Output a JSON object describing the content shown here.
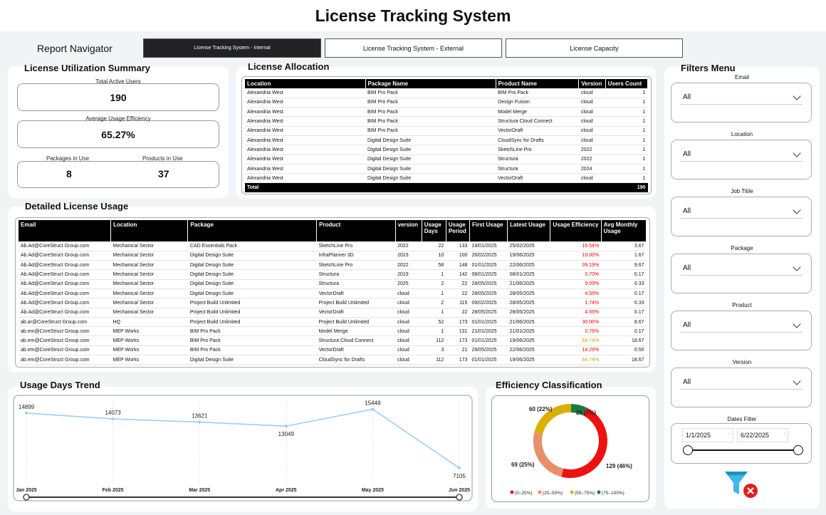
{
  "header": {
    "title": "License Tracking System"
  },
  "navigator": {
    "label": "Report Navigator",
    "buttons": [
      "License Tracking System - Internal",
      "License Tracking System - External",
      "License Capacity"
    ]
  },
  "summary": {
    "title": "License Utilization Summary",
    "total_users_label": "Total Active Users",
    "total_users": "190",
    "efficiency_label": "Average Usage Efficiency",
    "efficiency": "65.27%",
    "packages_label": "Packages in Use",
    "packages": "8",
    "products_label": "Products in Use",
    "products": "37"
  },
  "allocation": {
    "title": "License Allocation",
    "columns": [
      "Location",
      "Package Name",
      "Product Name",
      "Version",
      "Users Count"
    ],
    "rows": [
      [
        "Alexandria West",
        "BIM Pro Pack",
        "BIM Pro Pack",
        "cloud",
        "1"
      ],
      [
        "Alexandria West",
        "BIM Pro Pack",
        "Design Fusion",
        "cloud",
        "1"
      ],
      [
        "Alexandria West",
        "BIM Pro Pack",
        "Model Merge",
        "cloud",
        "1"
      ],
      [
        "Alexandria West",
        "BIM Pro Pack",
        "Structura Cloud Connect",
        "cloud",
        "1"
      ],
      [
        "Alexandria West",
        "BIM Pro Pack",
        "VectorDraft",
        "cloud",
        "1"
      ],
      [
        "Alexandria West",
        "Digital Design Suite",
        "CloudSync for Drafts",
        "cloud",
        "1"
      ],
      [
        "Alexandria West",
        "Digital Design Suite",
        "SketchLine Pro",
        "2022",
        "1"
      ],
      [
        "Alexandria West",
        "Digital Design Suite",
        "Structura",
        "2022",
        "1"
      ],
      [
        "Alexandria West",
        "Digital Design Suite",
        "Structura",
        "2024",
        "1"
      ],
      [
        "Alexandria West",
        "Digital Design Suite",
        "VectorDraft",
        "cloud",
        "1"
      ]
    ],
    "total_label": "Total",
    "total_value": "190"
  },
  "detail": {
    "title": "Detailed License Usage",
    "columns": [
      "Email",
      "Location",
      "Package",
      "Product",
      "version",
      "Usage Days",
      "Usage Period",
      "First Usage",
      "Latest Usage",
      "Usage Efficiency",
      "Avg Monthly Usage"
    ],
    "rows": [
      [
        "Ab.Ad@CoreStruct Group.com",
        "Mechanical Sector",
        "CAD Essentials Pack",
        "SketchLine Pro",
        "2022",
        "22",
        "133",
        "19/01/2025",
        "25/02/2025",
        "16.54%",
        "3.67"
      ],
      [
        "Ab.Ad@CoreStruct Group.com",
        "Mechanical Sector",
        "Digital Design Suite",
        "InfraPlanner 3D",
        "2023",
        "10",
        "100",
        "26/02/2025",
        "19/06/2025",
        "10.00%",
        "1.67"
      ],
      [
        "Ab.Ad@CoreStruct Group.com",
        "Mechanical Sector",
        "Digital Design Suite",
        "SketchLine Pro",
        "2022",
        "58",
        "148",
        "01/01/2025",
        "22/06/2025",
        "39.19%",
        "9.67"
      ],
      [
        "Ab.Ad@CoreStruct Group.com",
        "Mechanical Sector",
        "Digital Design Suite",
        "Structura",
        "2019",
        "1",
        "142",
        "08/01/2025",
        "08/01/2025",
        "0.70%",
        "0.17"
      ],
      [
        "Ab.Ad@CoreStruct Group.com",
        "Mechanical Sector",
        "Digital Design Suite",
        "Structura",
        "2025",
        "2",
        "22",
        "28/05/2025",
        "21/06/2025",
        "9.09%",
        "0.33"
      ],
      [
        "Ab.Ad@CoreStruct Group.com",
        "Mechanical Sector",
        "Digital Design Suite",
        "VectorDraft",
        "cloud",
        "1",
        "22",
        "28/05/2025",
        "28/05/2025",
        "4.55%",
        "0.17"
      ],
      [
        "Ab.Ad@CoreStruct Group.com",
        "Mechanical Sector",
        "Project Build Unlimited",
        "Project Build Unlimited",
        "cloud",
        "2",
        "115",
        "09/02/2025",
        "28/05/2025",
        "1.74%",
        "0.33"
      ],
      [
        "Ab.Ad@CoreStruct Group.com",
        "Mechanical Sector",
        "Project Build Unlimited",
        "VectorDraft",
        "cloud",
        "1",
        "22",
        "28/05/2025",
        "28/05/2025",
        "4.55%",
        "0.17"
      ],
      [
        "ab.ar@CoreStruct Group.com",
        "HQ",
        "Project Build Unlimited",
        "Project Build Unlimited",
        "cloud",
        "52",
        "173",
        "01/01/2025",
        "21/06/2025",
        "30.06%",
        "8.67"
      ],
      [
        "ab.em@CoreStruct Group.com",
        "MEP Works",
        "BIM Pro Pack",
        "Model Merge",
        "cloud",
        "1",
        "131",
        "21/01/2025",
        "21/01/2025",
        "0.76%",
        "0.17"
      ],
      [
        "ab.em@CoreStruct Group.com",
        "MEP Works",
        "BIM Pro Pack",
        "Structura Cloud Connect",
        "cloud",
        "112",
        "173",
        "01/01/2025",
        "19/06/2025",
        "64.74%",
        "18.67"
      ],
      [
        "ab.em@CoreStruct Group.com",
        "MEP Works",
        "BIM Pro Pack",
        "VectorDraft",
        "cloud",
        "3",
        "21",
        "29/05/2025",
        "22/06/2025",
        "14.29%",
        "0.50"
      ],
      [
        "ab.em@CoreStruct Group.com",
        "MEP Works",
        "Digital Design Suite",
        "CloudSync for Drafts",
        "cloud",
        "112",
        "173",
        "01/01/2025",
        "19/06/2025",
        "64.74%",
        "18.67"
      ]
    ],
    "efficiency_colors": [
      "red",
      "red",
      "red",
      "red",
      "red",
      "red",
      "red",
      "red",
      "red",
      "red",
      "amber",
      "red",
      "amber"
    ]
  },
  "trend": {
    "title": "Usage Days Trend"
  },
  "efficiency_chart": {
    "title": "Efficiency Classification"
  },
  "filters": {
    "title": "Filters Menu",
    "items": [
      {
        "label": "Email",
        "value": "All"
      },
      {
        "label": "Location",
        "value": "All"
      },
      {
        "label": "Job Titile",
        "value": "All"
      },
      {
        "label": "Package",
        "value": "All"
      },
      {
        "label": "Product",
        "value": "All"
      },
      {
        "label": "Version",
        "value": "All"
      }
    ],
    "dates_label": "Dates Filter",
    "date_start": "1/1/2025",
    "date_end": "6/22/2025"
  },
  "colors": {
    "accent_red": "#e00000",
    "donut_red": "#ee1111",
    "donut_orange": "#e8906a",
    "donut_yellow": "#d9b000",
    "donut_green": "#1a7a45",
    "line_blue": "#9ecdf3"
  },
  "chart_data": [
    {
      "type": "line",
      "categories": [
        "Jan 2025",
        "Feb 2025",
        "Mar 2025",
        "Apr 2025",
        "May 2025",
        "Jun 2025"
      ],
      "values": [
        14899,
        14073,
        13621,
        13049,
        15448,
        7105
      ],
      "title": "Usage Days Trend"
    },
    {
      "type": "pie",
      "title": "Efficiency Classification",
      "slices": [
        {
          "name": "(0–25%)",
          "value": 129,
          "label": "129 (46%)",
          "color": "#ee1111"
        },
        {
          "name": "(25–50%)",
          "value": 69,
          "label": "69 (25%)",
          "color": "#e8906a"
        },
        {
          "name": "(50–75%)",
          "value": 60,
          "label": "60 (22%)",
          "color": "#d9b000"
        },
        {
          "name": "(75–100%)",
          "value": 20,
          "label": "20 (7%)",
          "color": "#1a7a45"
        }
      ]
    }
  ]
}
